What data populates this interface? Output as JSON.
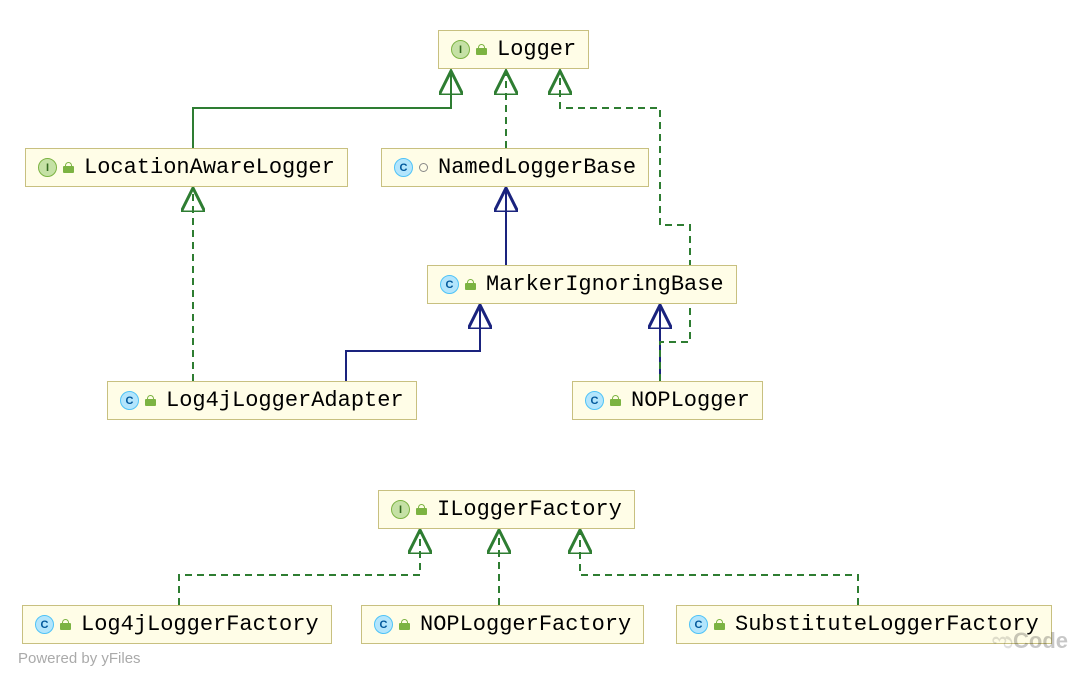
{
  "nodes": {
    "logger": {
      "label": "Logger",
      "kind": "interface"
    },
    "locationAwareLogger": {
      "label": "LocationAwareLogger",
      "kind": "interface"
    },
    "namedLoggerBase": {
      "label": "NamedLoggerBase",
      "kind": "class_abstract"
    },
    "markerIgnoringBase": {
      "label": "MarkerIgnoringBase",
      "kind": "class"
    },
    "log4jLoggerAdapter": {
      "label": "Log4jLoggerAdapter",
      "kind": "class"
    },
    "nopLogger": {
      "label": "NOPLogger",
      "kind": "class"
    },
    "iLoggerFactory": {
      "label": "ILoggerFactory",
      "kind": "interface"
    },
    "log4jLoggerFactory": {
      "label": "Log4jLoggerFactory",
      "kind": "class"
    },
    "nopLoggerFactory": {
      "label": "NOPLoggerFactory",
      "kind": "class"
    },
    "substituteLoggerFactory": {
      "label": "SubstituteLoggerFactory",
      "kind": "class"
    }
  },
  "relationships": [
    {
      "from": "locationAwareLogger",
      "to": "logger",
      "type": "extends_interface"
    },
    {
      "from": "namedLoggerBase",
      "to": "logger",
      "type": "implements"
    },
    {
      "from": "markerIgnoringBase",
      "to": "namedLoggerBase",
      "type": "extends_class"
    },
    {
      "from": "log4jLoggerAdapter",
      "to": "markerIgnoringBase",
      "type": "extends_class"
    },
    {
      "from": "log4jLoggerAdapter",
      "to": "locationAwareLogger",
      "type": "implements"
    },
    {
      "from": "nopLogger",
      "to": "markerIgnoringBase",
      "type": "extends_class"
    },
    {
      "from": "nopLogger",
      "to": "logger",
      "type": "implements"
    },
    {
      "from": "log4jLoggerFactory",
      "to": "iLoggerFactory",
      "type": "implements"
    },
    {
      "from": "nopLoggerFactory",
      "to": "iLoggerFactory",
      "type": "implements"
    },
    {
      "from": "substituteLoggerFactory",
      "to": "iLoggerFactory",
      "type": "implements"
    }
  ],
  "footer": {
    "poweredby": "Powered by yFiles"
  },
  "watermark": "Code"
}
